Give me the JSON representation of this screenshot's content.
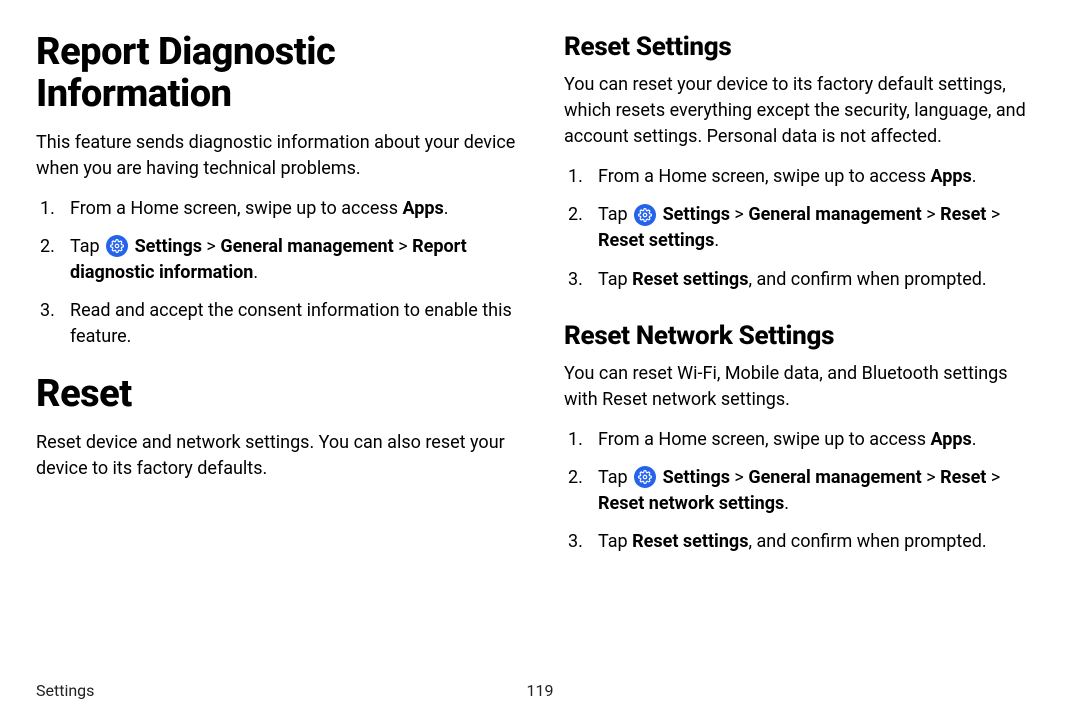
{
  "left": {
    "h1": "Report Diagnostic Information",
    "intro": "This feature sends diagnostic information about your device when you are having technical problems.",
    "steps": {
      "s1_a": "From a Home screen, swipe up to access ",
      "s1_b": "Apps",
      "s1_c": ".",
      "s2_a": "Tap ",
      "s2_b": " Settings",
      "s2_c": " > ",
      "s2_d": "General management",
      "s2_e": " > ",
      "s2_f": "Report diagnostic information",
      "s2_g": ".",
      "s3": "Read and accept the consent information to enable this feature."
    },
    "h1b": "Reset",
    "intro2": "Reset device and network settings. You can also reset your device to its factory defaults."
  },
  "right": {
    "sec1": {
      "h2": "Reset Settings",
      "intro": "You can reset your device to its factory default settings, which resets everything except the security, language, and account settings. Personal data is not affected.",
      "s1_a": "From a Home screen, swipe up to access ",
      "s1_b": "Apps",
      "s1_c": ".",
      "s2_a": "Tap ",
      "s2_b": " Settings",
      "s2_c": " > ",
      "s2_d": "General management",
      "s2_e": " > ",
      "s2_f": "Reset",
      "s2_g": " > ",
      "s2_h": "Reset settings",
      "s2_i": ".",
      "s3_a": "Tap ",
      "s3_b": "Reset settings",
      "s3_c": ", and confirm when prompted."
    },
    "sec2": {
      "h2": "Reset Network Settings",
      "intro": "You can reset Wi-Fi, Mobile data, and Bluetooth settings with Reset network settings.",
      "s1_a": "From a Home screen, swipe up to access ",
      "s1_b": "Apps",
      "s1_c": ".",
      "s2_a": "Tap ",
      "s2_b": " Settings",
      "s2_c": " > ",
      "s2_d": "General management",
      "s2_e": " > ",
      "s2_f": "Reset",
      "s2_g": " > ",
      "s2_h": "Reset network settings",
      "s2_i": ".",
      "s3_a": "Tap ",
      "s3_b": "Reset settings",
      "s3_c": ", and confirm when prompted."
    }
  },
  "footer": {
    "section": "Settings",
    "page": "119"
  }
}
